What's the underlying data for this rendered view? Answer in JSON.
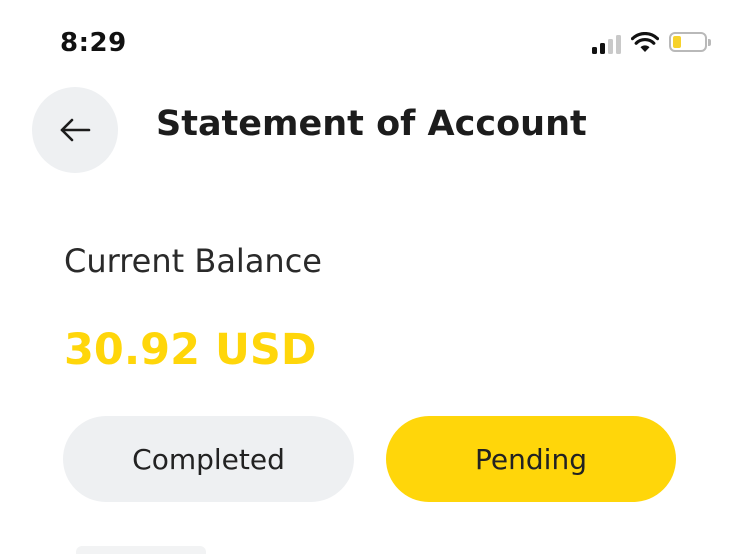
{
  "status_bar": {
    "time": "8:29",
    "signal_icon": "cellular-signal-icon",
    "wifi_icon": "wifi-icon",
    "battery_icon": "battery-low-icon",
    "battery_level": 0.2,
    "battery_color": "#f7d22b"
  },
  "header": {
    "back_icon": "arrow-left-icon",
    "title": "Statement of Account"
  },
  "balance": {
    "label": "Current Balance",
    "value": "30.92 USD",
    "value_color": "#ffd60a"
  },
  "tabs": [
    {
      "label": "Completed",
      "active": false
    },
    {
      "label": "Pending",
      "active": true
    }
  ],
  "colors": {
    "accent": "#ffd60a",
    "neutral_surface": "#eef0f2"
  }
}
